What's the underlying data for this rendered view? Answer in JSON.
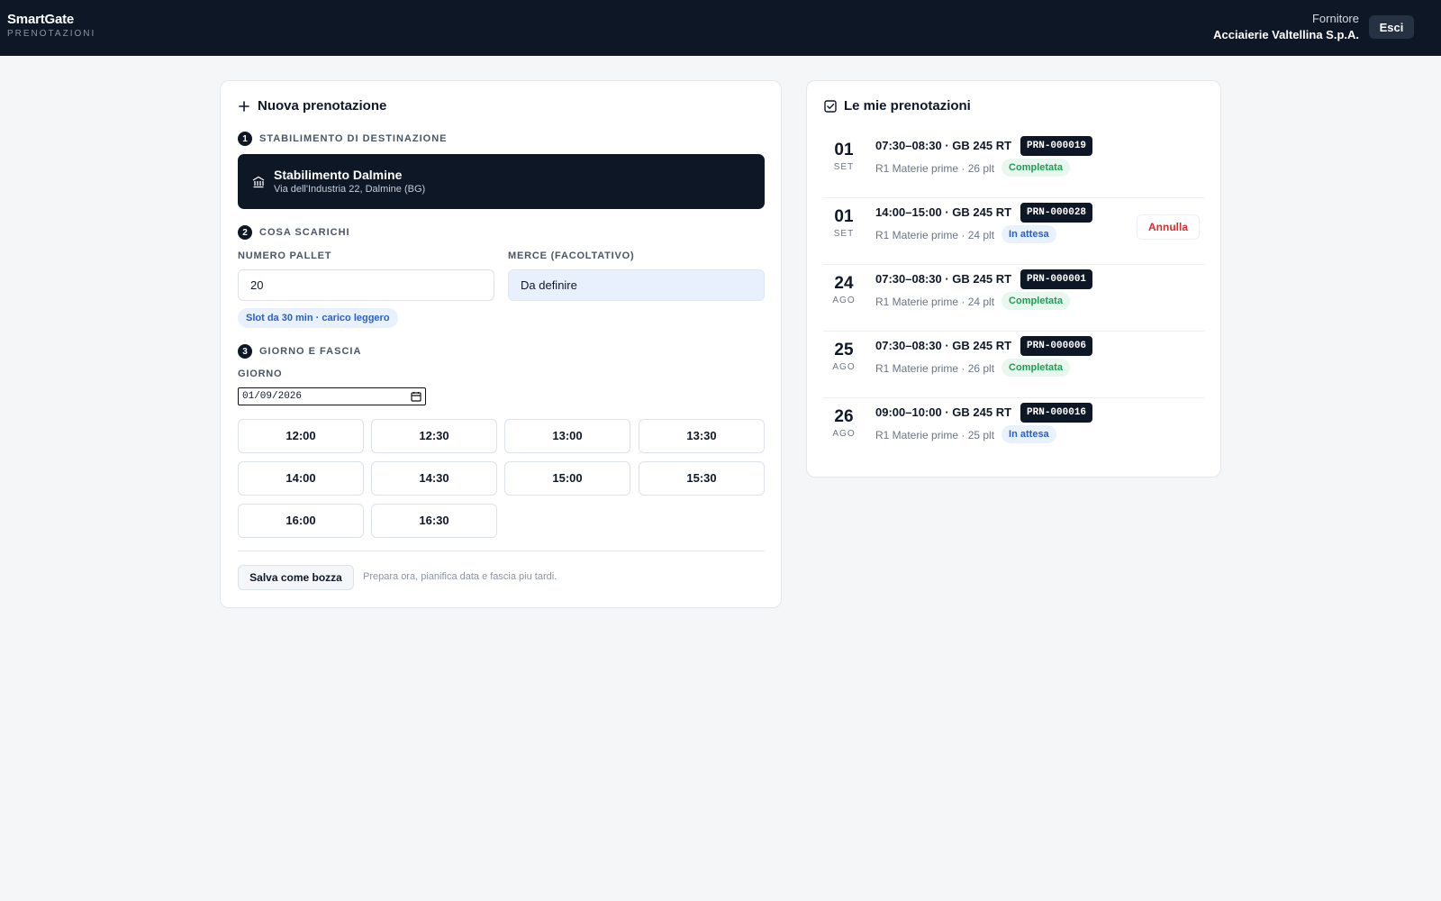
{
  "header": {
    "brand": "SmartGate",
    "brand_sub": "PRENOTAZIONI",
    "role": "Fornitore",
    "supplier": "Acciaierie Valtellina S.p.A.",
    "logout": "Esci"
  },
  "new_booking": {
    "title": "Nuova prenotazione",
    "step1": {
      "num": "1",
      "label": "STABILIMENTO DI DESTINAZIONE"
    },
    "plant": {
      "name": "Stabilimento Dalmine",
      "address": "Via dell'Industria 22, Dalmine (BG)"
    },
    "step2": {
      "num": "2",
      "label": "COSA SCARICHI"
    },
    "pallet_label": "NUMERO PALLET",
    "pallet_value": "20",
    "goods_label": "MERCE (FACOLTATIVO)",
    "goods_value": "Da definire",
    "slot_hint": "Slot da 30 min · carico leggero",
    "step3": {
      "num": "3",
      "label": "GIORNO E FASCIA"
    },
    "day_label": "GIORNO",
    "day_value": "01/09/2026",
    "slots": [
      "12:00",
      "12:30",
      "13:00",
      "13:30",
      "14:00",
      "14:30",
      "15:00",
      "15:30",
      "16:00",
      "16:30"
    ],
    "draft_button": "Salva come bozza",
    "draft_hint": "Prepara ora, pianifica data e fascia piu tardi."
  },
  "my_bookings": {
    "title": "Le mie prenotazioni",
    "cancel_label": "Annulla",
    "items": [
      {
        "day": "01",
        "month": "SET",
        "time": "07:30–08:30 · GB 245 RT",
        "code": "PRN-000019",
        "meta": "R1 Materie prime · 26 plt",
        "status": "Completata"
      },
      {
        "day": "01",
        "month": "SET",
        "time": "14:00–15:00 · GB 245 RT",
        "code": "PRN-000028",
        "meta": "R1 Materie prime · 24 plt",
        "status": "In attesa"
      },
      {
        "day": "24",
        "month": "AGO",
        "time": "07:30–08:30 · GB 245 RT",
        "code": "PRN-000001",
        "meta": "R1 Materie prime · 24 plt",
        "status": "Completata"
      },
      {
        "day": "25",
        "month": "AGO",
        "time": "07:30–08:30 · GB 245 RT",
        "code": "PRN-000006",
        "meta": "R1 Materie prime · 26 plt",
        "status": "Completata"
      },
      {
        "day": "26",
        "month": "AGO",
        "time": "09:00–10:00 · GB 245 RT",
        "code": "PRN-000016",
        "meta": "R1 Materie prime · 25 plt",
        "status": "In attesa"
      }
    ]
  },
  "colors": {
    "navy": "#0e1726",
    "completed": "#1f9d55",
    "pending": "#2a5fc4",
    "cancel": "#d22f2f"
  }
}
